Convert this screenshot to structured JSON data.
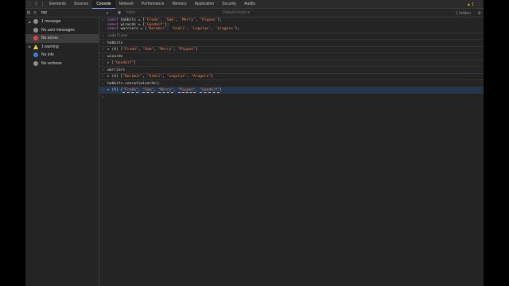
{
  "toolbar": {
    "tabs": [
      {
        "label": "Elements"
      },
      {
        "label": "Sources"
      },
      {
        "label": "Console"
      },
      {
        "label": "Network"
      },
      {
        "label": "Performance"
      },
      {
        "label": "Memory"
      },
      {
        "label": "Application"
      },
      {
        "label": "Security"
      },
      {
        "label": "Audits"
      }
    ],
    "warning_count": "1"
  },
  "filterbar": {
    "context": "top",
    "filter_placeholder": "Filter",
    "levels_label": "Default levels ▾",
    "hidden_label": "1 hidden"
  },
  "sidebar": {
    "items": [
      {
        "label": "1 message",
        "icon": "list-icon"
      },
      {
        "label": "No user messages",
        "icon": "user-icon"
      },
      {
        "label": "No errors",
        "icon": "error-icon"
      },
      {
        "label": "1 warning",
        "icon": "warning-icon"
      },
      {
        "label": "No info",
        "icon": "info-icon"
      },
      {
        "label": "No verbose",
        "icon": "verbose-icon"
      }
    ]
  },
  "console": {
    "input1": {
      "line1_kw": "const",
      "line1_rest": " hobbits = [",
      "line1_s1": "'Frodo'",
      "line1_s2": "'Sam'",
      "line1_s3": "'Merry'",
      "line1_s4": "'Pippen'",
      "line2_kw": "const",
      "line2_rest": " wizards = [",
      "line2_s1": "'Gandolf'",
      "line3_kw": "const",
      "line3_rest": " warriors = [",
      "line3_s1": "'Boromir'",
      "line3_s2": "'Gimli'",
      "line3_s3": "'Legolas'",
      "line3_s4": "'Aragorn'"
    },
    "undefined_label": "undefined",
    "cmd_hobbits": "hobbits",
    "out_hobbits": {
      "prefix": "▸ (4) [",
      "items": [
        "\"Frodo\"",
        "\"Sam\"",
        "\"Merry\"",
        "\"Pippen\""
      ]
    },
    "cmd_wizards": "wizards",
    "out_wizards": {
      "prefix": "▸ [",
      "items": [
        "\"Gandolf\""
      ]
    },
    "cmd_warriors": "warriors",
    "out_warriors": {
      "prefix": "▸ (4) [",
      "items": [
        "\"Boromir\"",
        "\"Gimli\"",
        "\"Legolas\"",
        "\"Aragorn\""
      ]
    },
    "cmd_concat": "hobbits.concat(wizards);",
    "out_concat": {
      "prefix": "▸ (5) [",
      "items": [
        "\"Frodo\"",
        "\"Sam\"",
        "\"Merry\"",
        "\"Pippen\"",
        "\"Gandolf\""
      ]
    }
  },
  "colors": {
    "accent": "#7aa7ff",
    "string": "#f28b54",
    "keyword": "#c586e8",
    "warning": "#f2c94c",
    "error": "#e34646"
  }
}
